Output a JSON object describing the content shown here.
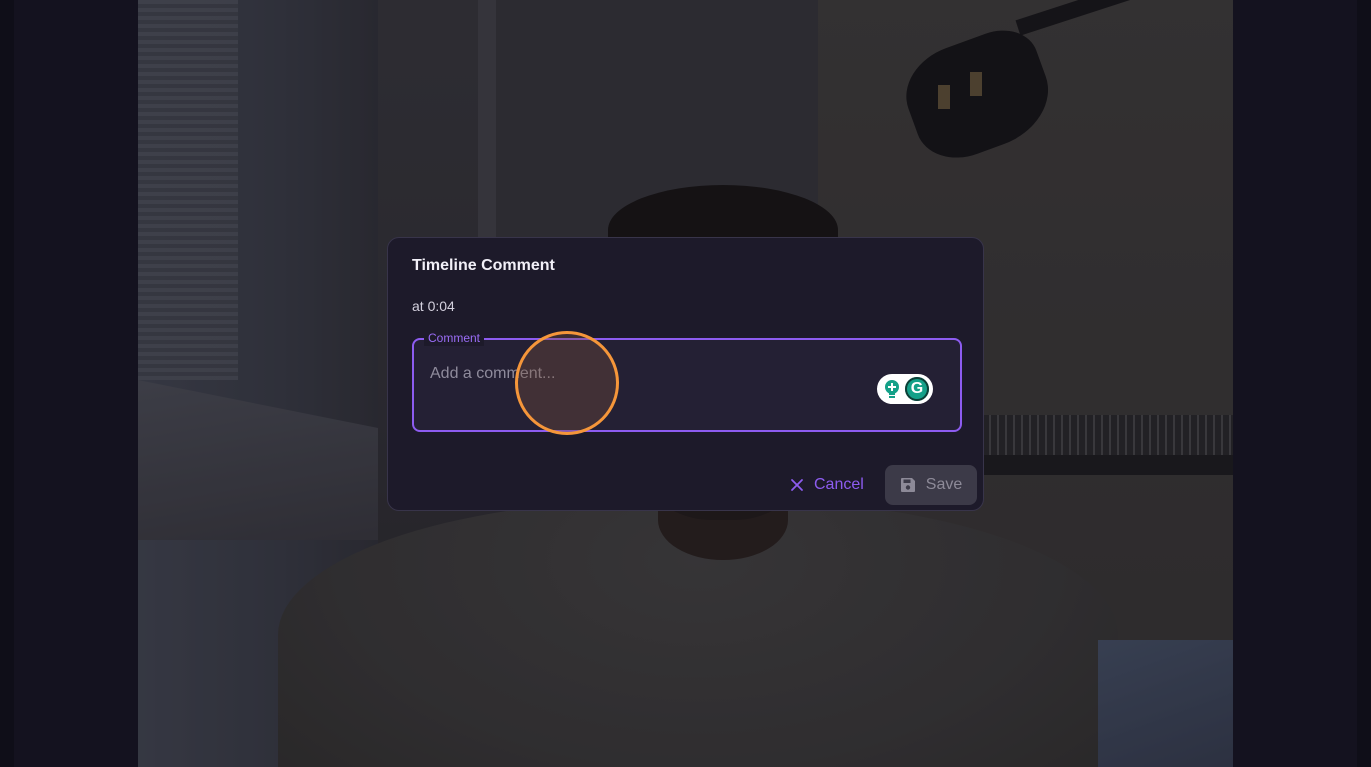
{
  "dialog": {
    "title": "Timeline Comment",
    "timestamp": "at 0:04",
    "comment_label": "Comment",
    "comment_placeholder": "Add a comment...",
    "comment_value": "",
    "cancel_label": "Cancel",
    "save_label": "Save",
    "save_disabled": true
  },
  "colors": {
    "accent": "#8d5cf0",
    "click_indicator": "#f5963a",
    "grammarly": "#14a088"
  }
}
